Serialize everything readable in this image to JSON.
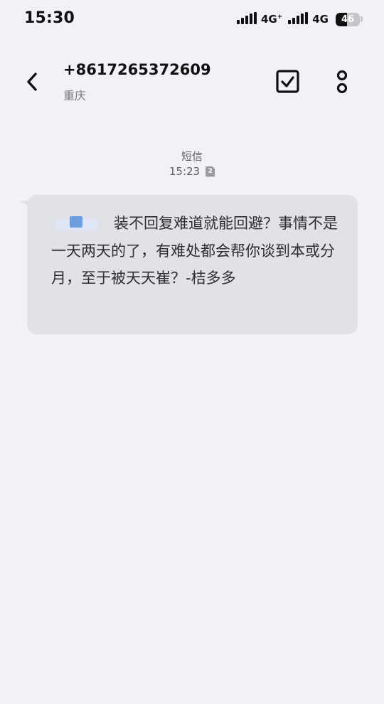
{
  "status_bar": {
    "time": "15:30",
    "network_1": "4G",
    "network_1_suffix": "+",
    "network_2": "4G",
    "battery_level": "46",
    "battery_fraction": 0.46
  },
  "header": {
    "back_icon": "chevron-left-icon",
    "contact_number": "+8617265372609",
    "contact_location": "重庆",
    "select_icon": "checkbox-icon",
    "more_icon": "more-vertical-icon"
  },
  "conversation": {
    "channel_label": "短信",
    "timestamp": "15:23",
    "sim_slot": "2",
    "message": {
      "text": "装不回复难道就能回避？事情不是一天两天的了，有难处都会帮你谈到本或分月，至于被天天崔？-桔多多",
      "redacted_prefix": true
    }
  },
  "colors": {
    "background": "#f2f1f7",
    "bubble": "#e1e1e8",
    "text_primary": "#111111",
    "text_secondary": "#7a7a80"
  }
}
